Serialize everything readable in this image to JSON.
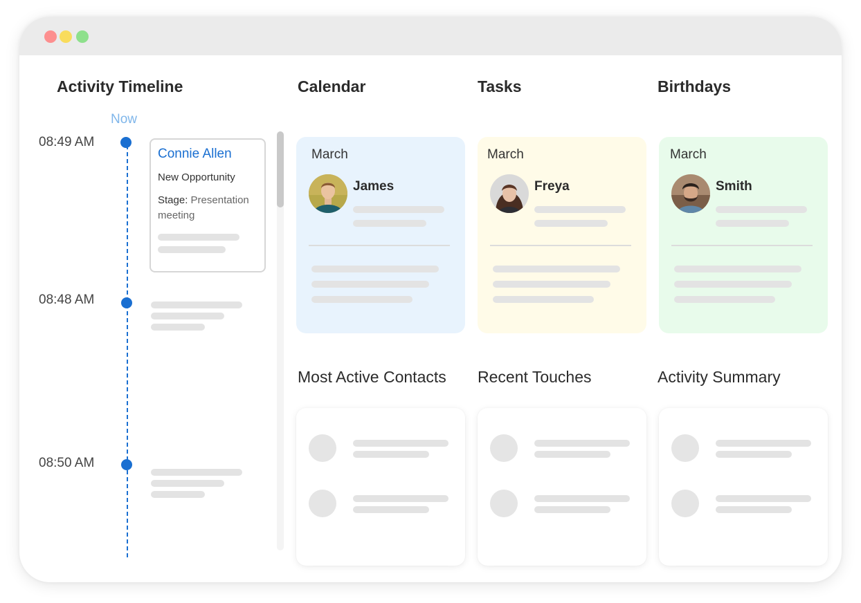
{
  "colors": {
    "accent_blue": "#1a6fd1",
    "now_blue": "#7fb6ea",
    "calendar_bg": "#e8f3fd",
    "tasks_bg": "#fffbe8",
    "birthdays_bg": "#e8fbeb",
    "traffic_red": "#fd8f8f",
    "traffic_yellow": "#f9dc5c",
    "traffic_green": "#8ee08c"
  },
  "timeline": {
    "title": "Activity Timeline",
    "now_label": "Now",
    "events": [
      {
        "time": "08:49 AM",
        "name": "Connie Allen",
        "type": "New Opportunity",
        "stage_label": "Stage:",
        "stage_value": "Presentation meeting"
      },
      {
        "time": "08:48 AM"
      },
      {
        "time": "08:50 AM"
      }
    ]
  },
  "widgets": {
    "calendar": {
      "title": "Calendar",
      "month": "March",
      "person": "James",
      "avatar_icon": "avatar-photo-icon"
    },
    "tasks": {
      "title": "Tasks",
      "month": "March",
      "person": "Freya",
      "avatar_icon": "avatar-photo-icon"
    },
    "birthdays": {
      "title": "Birthdays",
      "month": "March",
      "person": "Smith",
      "avatar_icon": "avatar-photo-icon"
    },
    "most_active": {
      "title": "Most Active Contacts"
    },
    "recent_touches": {
      "title": "Recent Touches"
    },
    "activity_summary": {
      "title": "Activity Summary"
    }
  }
}
